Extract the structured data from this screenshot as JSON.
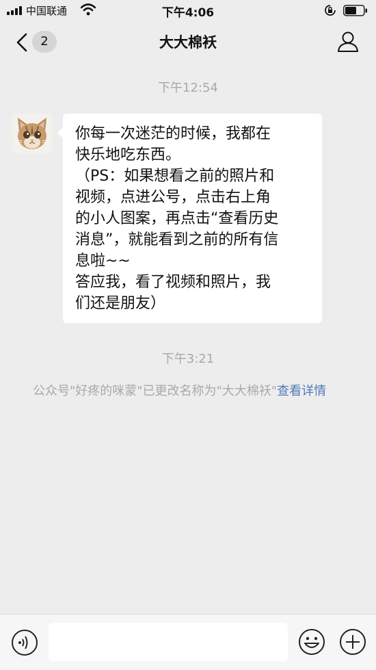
{
  "status_bar": {
    "carrier": "中国联通",
    "time": "下午4:06",
    "icons": [
      "signal-icon",
      "wifi-icon",
      "rotation-lock-icon",
      "battery-icon"
    ]
  },
  "nav": {
    "back_icon": "chevron-left-icon",
    "unread_count": "2",
    "title": "大大棉袄",
    "profile_icon": "person-icon"
  },
  "messages": [
    {
      "time": "下午12:54",
      "sender_avatar": "cat-avatar",
      "lines": [
        "你每一次迷茫的时候，我都在",
        "快乐地吃东西。",
        "（PS：如果想看之前的照片和",
        "视频，点进公号，点击右上角",
        "的小人图案，再点击“查看历史",
        "消息”，就能看到之前的所有信",
        "息啦~~",
        "答应我，看了视频和照片，我",
        "们还是朋友）"
      ]
    }
  ],
  "system": {
    "time": "下午3:21",
    "notice": "公众号\"好疼的咪蒙\"已更改名称为\"大大棉袄\"",
    "link": "查看详情"
  },
  "input_bar": {
    "voice_icon": "voice-icon",
    "text_value": "",
    "emoji_icon": "emoji-icon",
    "plus_icon": "plus-icon"
  },
  "colors": {
    "background": "#ededed",
    "bubble": "#ffffff",
    "secondary_text": "#a9a9a9",
    "link": "#4f7bb6"
  }
}
